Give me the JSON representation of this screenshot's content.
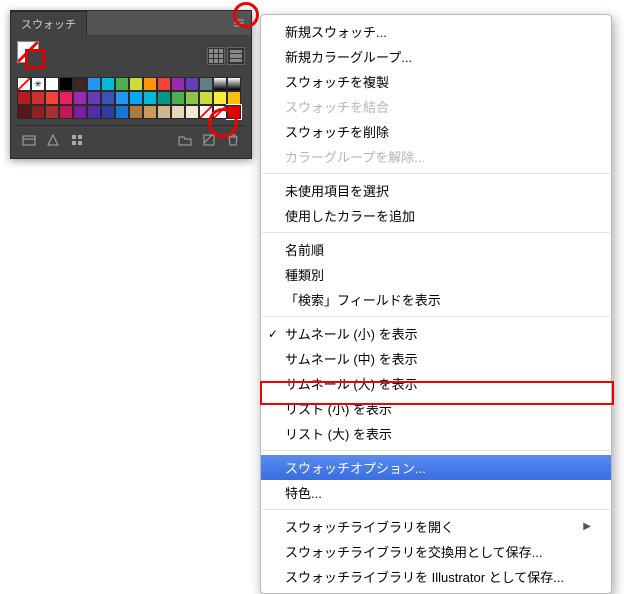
{
  "panel": {
    "title": "スウォッチ",
    "swatches": [
      {
        "type": "none"
      },
      {
        "type": "reg"
      },
      {
        "c": "#ffffff"
      },
      {
        "c": "#000000"
      },
      {
        "c": "#3e2723"
      },
      {
        "c": "#2196f3"
      },
      {
        "c": "#00bcd4"
      },
      {
        "c": "#4caf50"
      },
      {
        "c": "#cddc39"
      },
      {
        "c": "#ff9800"
      },
      {
        "c": "#f44336"
      },
      {
        "c": "#9c27b0"
      },
      {
        "c": "#673ab7"
      },
      {
        "c": "#607d8b"
      },
      {
        "type": "grad"
      },
      {
        "type": "grad"
      },
      {
        "c": "#b71c1c"
      },
      {
        "c": "#d32f2f"
      },
      {
        "c": "#f44336"
      },
      {
        "c": "#e91e63"
      },
      {
        "c": "#9c27b0"
      },
      {
        "c": "#673ab7"
      },
      {
        "c": "#3f51b5"
      },
      {
        "c": "#2196f3"
      },
      {
        "c": "#03a9f4"
      },
      {
        "c": "#00bcd4"
      },
      {
        "c": "#009688"
      },
      {
        "c": "#4caf50"
      },
      {
        "c": "#8bc34a"
      },
      {
        "c": "#cddc39"
      },
      {
        "c": "#ffeb3b"
      },
      {
        "c": "#ffc107"
      },
      {
        "c": "#5d1414"
      },
      {
        "c": "#8d2222"
      },
      {
        "c": "#a83232"
      },
      {
        "c": "#c2185b"
      },
      {
        "c": "#7b1fa2"
      },
      {
        "c": "#512da8"
      },
      {
        "c": "#303f9f"
      },
      {
        "c": "#1976d2"
      },
      {
        "c": "#ad7b3f"
      },
      {
        "c": "#c79a5f"
      },
      {
        "c": "#d2b48c"
      },
      {
        "c": "#e8d5b5"
      },
      {
        "c": "#f0e6d2"
      },
      {
        "type": "none"
      },
      {
        "type": "none"
      },
      {
        "c": "#d00",
        "selected": true
      }
    ]
  },
  "menu": {
    "newSwatch": "新規スウォッチ...",
    "newColorGroup": "新規カラーグループ...",
    "duplicate": "スウォッチを複製",
    "merge": "スウォッチを結合",
    "delete": "スウォッチを削除",
    "ungroup": "カラーグループを解除...",
    "selectUnused": "未使用項目を選択",
    "addUsed": "使用したカラーを追加",
    "byName": "名前順",
    "byKind": "種類別",
    "showFind": "「検索」フィールドを表示",
    "thumbS": "サムネール (小) を表示",
    "thumbM": "サムネール (中) を表示",
    "thumbL": "サムネール (大) を表示",
    "listS": "リスト (小) を表示",
    "listL": "リスト (大) を表示",
    "swatchOptions": "スウォッチオプション...",
    "spot": "特色...",
    "openLib": "スウォッチライブラリを開く",
    "saveExchange": "スウォッチライブラリを交換用として保存...",
    "saveAI": "スウォッチライブラリを Illustrator として保存..."
  }
}
